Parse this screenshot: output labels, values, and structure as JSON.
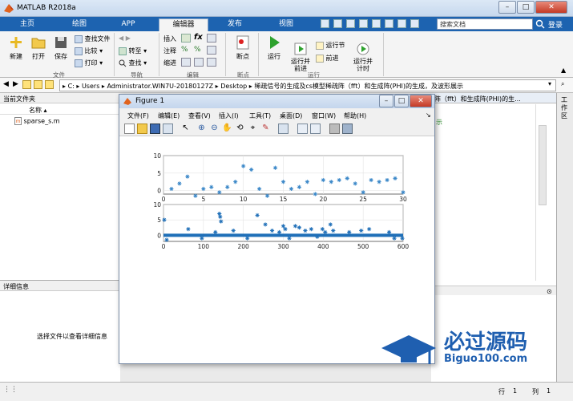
{
  "app": {
    "title": "MATLAB R2018a"
  },
  "search": {
    "placeholder": "搜索文档",
    "login": "登录"
  },
  "tabs": [
    "主页",
    "绘图",
    "APP",
    "编辑器",
    "发布",
    "视图"
  ],
  "ribbon": {
    "new": "新建",
    "open": "打开",
    "save": "保存",
    "find_files": "查找文件",
    "compare": "比较",
    "print": "打印",
    "goto": "转至",
    "find": "查找",
    "insert": "插入",
    "comment": "注释",
    "indent": "缩进",
    "breakpoints": "断点",
    "run": "运行",
    "run_advance": "运行并\n前进",
    "run_section": "运行节",
    "advance": "前进",
    "run_time": "运行并\n计时",
    "groups": {
      "file": "文件",
      "nav": "导航",
      "edit": "编辑",
      "breakpoints": "断点",
      "run": "运行"
    }
  },
  "address": {
    "path": [
      "C:",
      "Users",
      "Administrator.WIN7U-20180127Z",
      "Desktop",
      "稀疏信号的生成及cs模型稀疏阵（fft）和生成阵(PHI)的生成，及波形展示"
    ]
  },
  "current_folder": {
    "header": "当前文件夹",
    "col_name": "名称",
    "file": "sparse_s.m"
  },
  "details": {
    "header": "详细信息",
    "hint": "选择文件以查看详细信息"
  },
  "editor_tab": {
    "title": "阵（fft）和生成阵(PHI)的生..."
  },
  "editor_snippet": "示",
  "side_tab": {
    "label": "工作区"
  },
  "status": {
    "row_label": "行",
    "row": "1",
    "col_label": "列",
    "col": "1"
  },
  "figure": {
    "title": "Figure 1",
    "menus": [
      "文件(F)",
      "编辑(E)",
      "查看(V)",
      "插入(I)",
      "工具(T)",
      "桌面(D)",
      "窗口(W)",
      "帮助(H)"
    ]
  },
  "logo": {
    "text": "必过源码",
    "sub": "Biguo100.com"
  },
  "chart_data": [
    {
      "type": "scatter",
      "marker": "*",
      "color": "#3a87c8",
      "xlim": [
        0,
        30
      ],
      "ylim": [
        -1,
        10
      ],
      "xticks": [
        "0",
        "5",
        "10",
        "15",
        "20",
        "25",
        "30"
      ],
      "yticks": [
        "10",
        "5",
        "0"
      ],
      "grid": true,
      "x": [
        1,
        2,
        3,
        4,
        5,
        6,
        7,
        8,
        9,
        10,
        11,
        12,
        13,
        14,
        15,
        16,
        17,
        18,
        19,
        20,
        21,
        22,
        23,
        24,
        25,
        26,
        27,
        28,
        29,
        30
      ],
      "y": [
        0.5,
        2,
        4,
        -1.5,
        0.5,
        1,
        -0.5,
        1,
        2.5,
        7,
        6,
        0.5,
        -1.5,
        6.5,
        2.5,
        0.5,
        1,
        2.5,
        -1,
        3,
        2.5,
        3,
        3.5,
        2,
        -0.5,
        3,
        2.5,
        3,
        3.5,
        -0.5
      ]
    },
    {
      "type": "scatter",
      "marker": "*",
      "color": "#1f6fb8",
      "xlim": [
        0,
        600
      ],
      "ylim": [
        -2,
        10
      ],
      "xticks": [
        "0",
        "100",
        "200",
        "300",
        "400",
        "500",
        "600"
      ],
      "yticks": [
        "10",
        "5",
        "0"
      ],
      "grid": true,
      "baseline": 0,
      "x": [
        2,
        8,
        62,
        96,
        130,
        140,
        142,
        144,
        175,
        210,
        235,
        255,
        272,
        290,
        300,
        305,
        315,
        330,
        340,
        355,
        370,
        385,
        398,
        405,
        418,
        425,
        465,
        495,
        515,
        565,
        578,
        598
      ],
      "y": [
        5,
        -1.5,
        2,
        -1,
        1,
        7,
        6,
        4.5,
        1.5,
        -1,
        6.5,
        3.5,
        1.5,
        1,
        3,
        2,
        -1,
        3,
        2.5,
        1.5,
        2,
        -0.5,
        2,
        1,
        3.5,
        1.5,
        1,
        1.5,
        2,
        1,
        -1,
        -1
      ]
    }
  ]
}
